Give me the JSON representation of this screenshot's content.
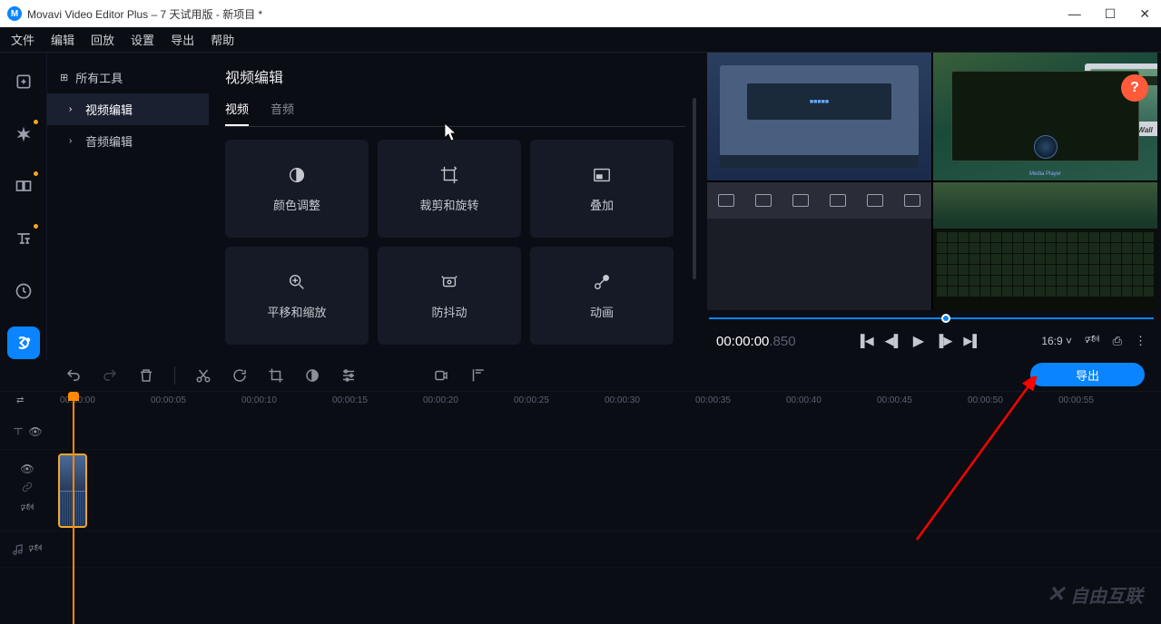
{
  "title_bar": {
    "app_name": "Movavi Video Editor Plus – 7 天试用版 - 新项目 *",
    "logo_char": "M"
  },
  "menu": {
    "file": "文件",
    "edit": "编辑",
    "playback": "回放",
    "settings": "设置",
    "export": "导出",
    "help": "帮助"
  },
  "tree": {
    "all_tools": "所有工具",
    "video_edit": "视频编辑",
    "audio_edit": "音频编辑"
  },
  "panel": {
    "title": "视频编辑",
    "tab_video": "视频",
    "tab_audio": "音频",
    "cards": {
      "color": "颜色调整",
      "crop": "裁剪和旋转",
      "overlay": "叠加",
      "panzoom": "平移和缩放",
      "stabilize": "防抖动",
      "animation": "动画"
    }
  },
  "preview": {
    "help": "?",
    "time_main": "00:00:00",
    "time_ms": ".850",
    "ratio": "16:9",
    "monitor_brand": "Great Wall"
  },
  "export_button": "导出",
  "ruler": {
    "t0": "00:00:00",
    "t1": "00:00:05",
    "t2": "00:00:10",
    "t3": "00:00:15",
    "t4": "00:00:20",
    "t5": "00:00:25",
    "t6": "00:00:30",
    "t7": "00:00:35",
    "t8": "00:00:40",
    "t9": "00:00:45",
    "t10": "00:00:50",
    "t11": "00:00:55"
  },
  "watermark": {
    "text": "自由互联"
  }
}
